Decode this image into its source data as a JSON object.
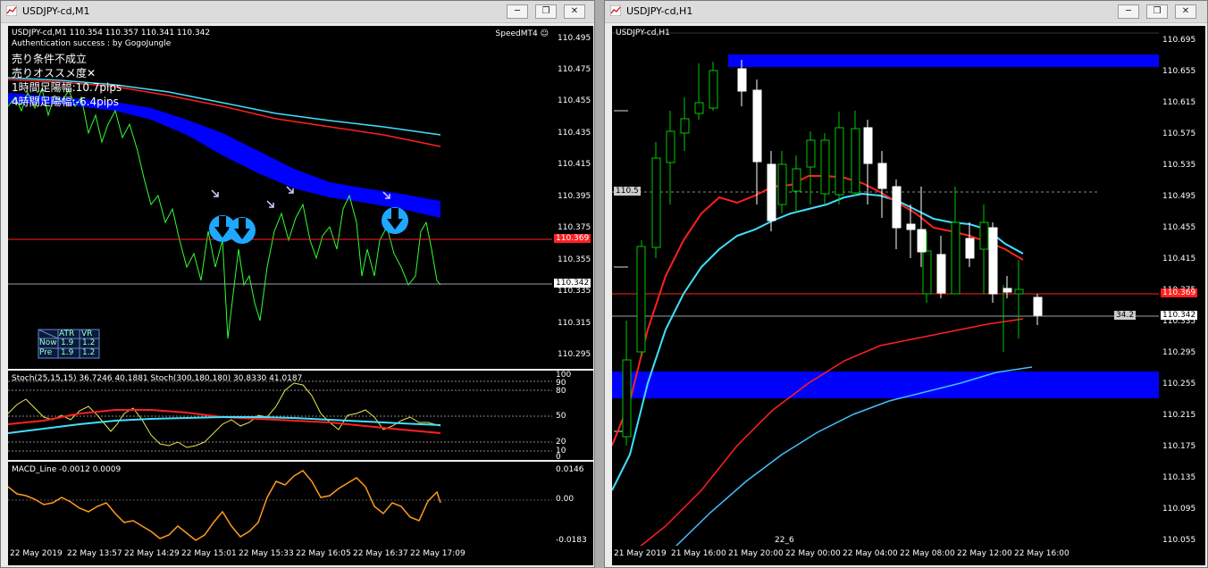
{
  "left_window": {
    "title": "USDJPY-cd,M1",
    "buttons": {
      "minimize": "─",
      "restore": "❐",
      "close": "✕"
    },
    "symbol_line": "USDJPY-cd,M1  110.354 110.357 110.341 110.342",
    "auth_text": "Authentication success : by GogoJungle",
    "indicator_label": "SpeedMT4 ☺",
    "jp_lines": [
      "売り条件不成立",
      "売りオススメ度✕",
      "1時間足陽幅:10.7pips",
      "4時間足陽幅:-6.4pips"
    ],
    "price_axis": [
      "110.495",
      "110.475",
      "110.455",
      "110.435",
      "110.415",
      "110.395",
      "110.375",
      "110.355",
      "110.335",
      "110.315",
      "110.295"
    ],
    "red_line_price": "110.369",
    "bid_price": "110.342",
    "atr_table": {
      "headers": [
        "",
        "ATR",
        "VR"
      ],
      "rows": [
        [
          "Now",
          "1.9",
          "1.2"
        ],
        [
          "Pre",
          "1.9",
          "1.2"
        ]
      ]
    },
    "stoch_label": "Stoch(25,15,15) 36.7246 40.1881  Stoch(300,180,180) 30.8330 41.0187",
    "stoch_axis": [
      "100",
      "90",
      "80",
      "50",
      "20",
      "10",
      "0"
    ],
    "macd_label": "MACD_Line -0.0012 0.0009",
    "macd_axis": [
      "0.0146",
      "0.00",
      "-0.0183"
    ],
    "time_axis": [
      "22 May 2019",
      "22 May 13:57",
      "22 May 14:29",
      "22 May 15:01",
      "22 May 15:33",
      "22 May 16:05",
      "22 May 16:37",
      "22 May 17:09"
    ]
  },
  "right_window": {
    "title": "USDJPY-cd,H1",
    "buttons": {
      "minimize": "─",
      "restore": "❐",
      "close": "✕"
    },
    "symbol_line": "USDJPY-cd,H1",
    "level_label": "110.5",
    "pips_label": "34.2",
    "price_axis": [
      "110.695",
      "110.655",
      "110.615",
      "110.575",
      "110.535",
      "110.495",
      "110.455",
      "110.415",
      "110.375",
      "110.335",
      "110.295",
      "110.255",
      "110.215",
      "110.175",
      "110.135",
      "110.095",
      "110.055"
    ],
    "red_line_price": "110.369",
    "bid_price": "110.342",
    "period_separator_label": "22_6",
    "time_axis": [
      "21 May 2019",
      "21 May 16:00",
      "21 May 20:00",
      "22 May 00:00",
      "22 May 04:00",
      "22 May 08:00",
      "22 May 12:00",
      "22 May 16:00"
    ]
  },
  "colors": {
    "background": "#000000",
    "bull_candle": "#00c800",
    "bear_candle": "#ffffff",
    "ma_red": "#ff2020",
    "ma_cyan": "#40e0ff",
    "band_blue": "#0000ff",
    "price_line": "#00ff00"
  }
}
